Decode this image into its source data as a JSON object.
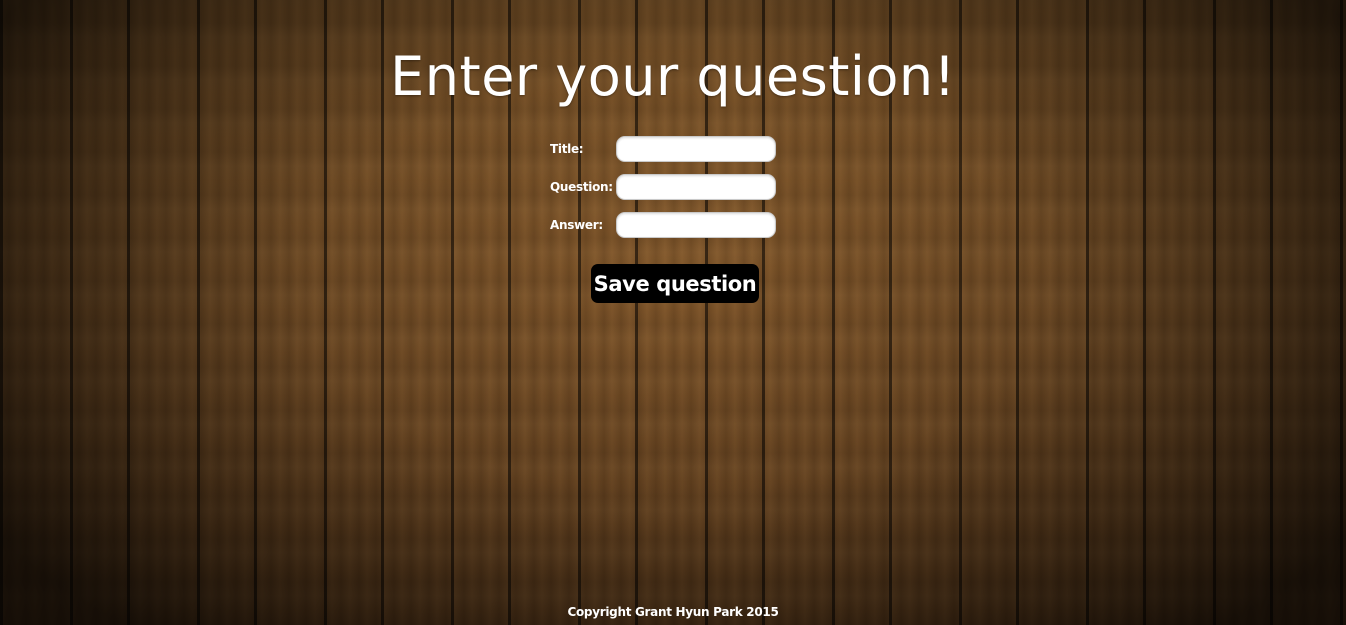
{
  "page": {
    "title": "Enter your question!"
  },
  "form": {
    "fields": [
      {
        "label": "Title:",
        "value": "",
        "placeholder": ""
      },
      {
        "label": "Question:",
        "value": "",
        "placeholder": ""
      },
      {
        "label": "Answer:",
        "value": "",
        "placeholder": ""
      }
    ],
    "submit_label": "Save question"
  },
  "footer": {
    "text": "Copyright Grant Hyun Park 2015"
  },
  "colors": {
    "text": "#ffffff",
    "button_background": "#000000",
    "input_background": "#ffffff",
    "wood": "#7a5127"
  }
}
